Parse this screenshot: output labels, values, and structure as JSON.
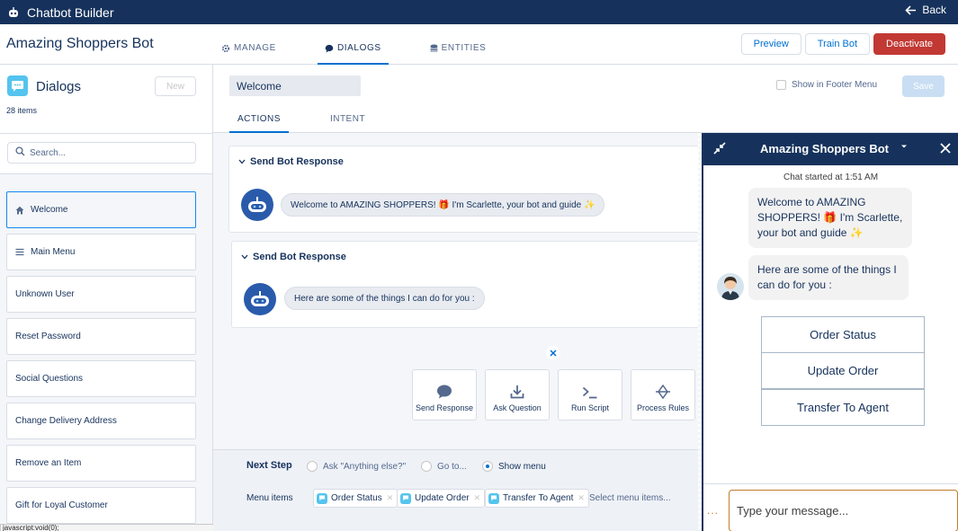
{
  "topbar": {
    "title": "Chatbot Builder",
    "back_label": "Back"
  },
  "header": {
    "bot_name": "Amazing Shoppers Bot",
    "tabs": [
      {
        "label": "MANAGE",
        "icon": "gear-icon"
      },
      {
        "label": "DIALOGS",
        "icon": "chat-icon"
      },
      {
        "label": "ENTITIES",
        "icon": "database-icon"
      }
    ],
    "buttons": {
      "preview": "Preview",
      "train": "Train Bot",
      "deactivate": "Deactivate"
    }
  },
  "sidebar": {
    "title": "Dialogs",
    "count": "28 items",
    "new_label": "New",
    "search_placeholder": "Search...",
    "items": [
      {
        "label": "Welcome",
        "icon": "home-icon"
      },
      {
        "label": "Main Menu",
        "icon": "menu-icon"
      },
      {
        "label": "Unknown User"
      },
      {
        "label": "Reset Password"
      },
      {
        "label": "Social Questions"
      },
      {
        "label": "Change Delivery Address"
      },
      {
        "label": "Remove an Item"
      },
      {
        "label": "Gift for Loyal Customer"
      }
    ]
  },
  "status_url": "javascript:void(0);",
  "main": {
    "dialog_name": "Welcome",
    "show_in_footer_label": "Show in Footer Menu",
    "save_label": "Save",
    "subtabs": [
      "ACTIONS",
      "INTENT"
    ],
    "cards": [
      {
        "title": "Send Bot Response",
        "message": "Welcome to AMAZING SHOPPERS! 🎁 I'm Scarlette, your bot and guide ✨"
      },
      {
        "title": "Send Bot Response",
        "message": "Here are some of the things I can do for you :"
      }
    ],
    "actions": [
      "Send Response",
      "Ask Question",
      "Run Script",
      "Process Rules"
    ],
    "next_step": {
      "label": "Next Step",
      "options": [
        "Ask \"Anything else?\"",
        "Go to...",
        "Show menu"
      ],
      "selected": "Show menu",
      "menu_items_label": "Menu items",
      "menu_items": [
        "Order Status",
        "Update Order",
        "Transfer To Agent"
      ],
      "select_placeholder": "Select menu items..."
    }
  },
  "chat": {
    "title": "Amazing Shoppers Bot",
    "started": "Chat started at 1:51 AM",
    "messages": [
      "Welcome to AMAZING SHOPPERS! 🎁 I'm Scarlette, your bot and guide ✨",
      "Here are some of the things I can do for you :"
    ],
    "menu": [
      "Order Status",
      "Update Order",
      "Transfer To Agent"
    ],
    "input_placeholder": "Type your message...",
    "typing_indicator": "..."
  },
  "colors": {
    "navy": "#16325c",
    "brand_blue": "#0070d2",
    "danger": "#c23934",
    "dialog_icon": "#54c4ee"
  }
}
